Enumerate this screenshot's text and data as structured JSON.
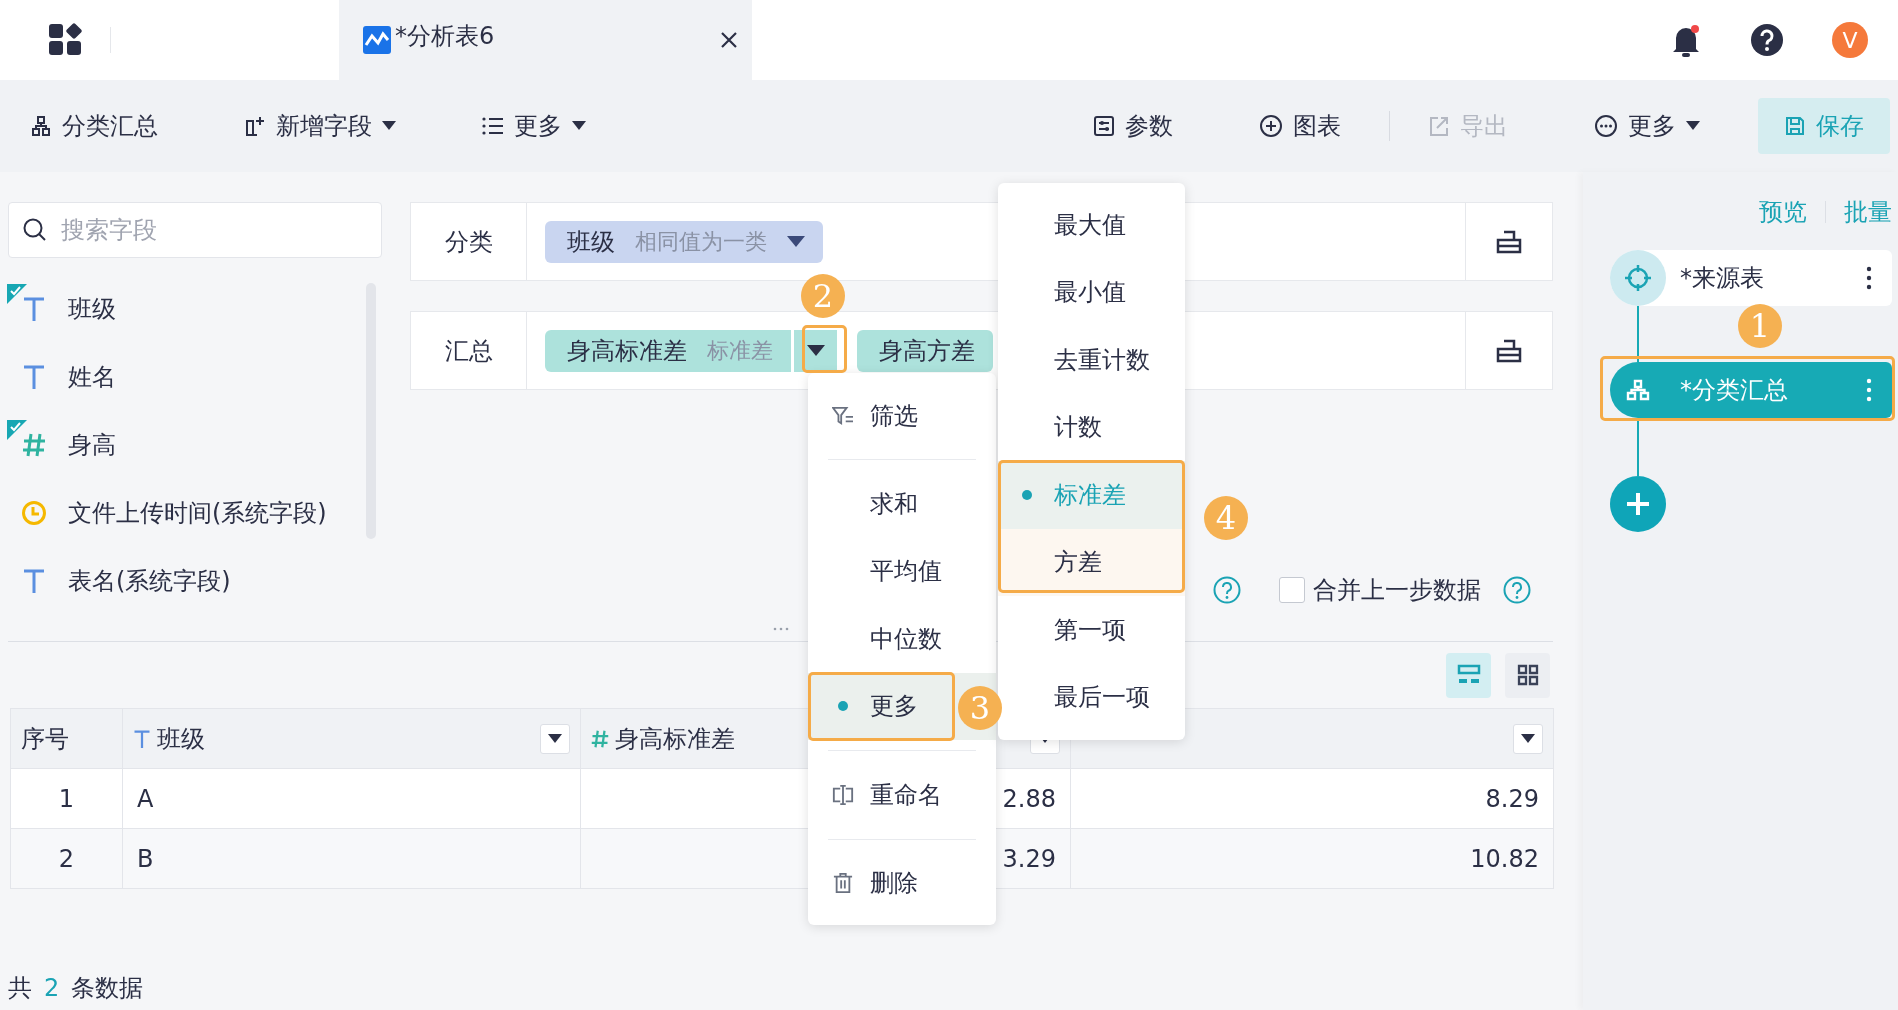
{
  "app_tab": {
    "title": "*分析表6"
  },
  "avatar": "V",
  "toolbar": {
    "left": [
      {
        "label": "分类汇总",
        "kind": "hierarchy",
        "dropdown": false,
        "disabled": false
      },
      {
        "label": "新增字段",
        "kind": "add-column",
        "dropdown": true,
        "disabled": false
      },
      {
        "label": "更多",
        "kind": "list",
        "dropdown": true,
        "disabled": false
      }
    ],
    "right": [
      {
        "label": "参数",
        "kind": "params",
        "dropdown": false,
        "disabled": false
      },
      {
        "label": "图表",
        "kind": "add",
        "dropdown": false,
        "disabled": false
      },
      {
        "label": "导出",
        "kind": "export",
        "dropdown": false,
        "disabled": true
      },
      {
        "label": "更多",
        "kind": "more",
        "dropdown": true,
        "disabled": false
      }
    ],
    "save": "保存"
  },
  "field_search": {
    "placeholder": "搜索字段"
  },
  "fields": [
    {
      "name": "班级",
      "kind": "text",
      "checked": true
    },
    {
      "name": "姓名",
      "kind": "text",
      "checked": false
    },
    {
      "name": "身高",
      "kind": "number",
      "checked": true
    },
    {
      "name": "文件上传时间(系统字段)",
      "kind": "time",
      "checked": false
    },
    {
      "name": "表名(系统字段)",
      "kind": "text",
      "checked": false
    }
  ],
  "config_rows": [
    {
      "label": "分类",
      "chips": [
        {
          "name": "班级",
          "hint": "相同值为一类",
          "kind": "dimension",
          "toggle": true
        }
      ]
    },
    {
      "label": "汇总",
      "chips": [
        {
          "name": "身高标准差",
          "hint": "标准差",
          "kind": "measure",
          "toggle": true
        },
        {
          "name": "身高方差",
          "kind": "measure",
          "toggle": false
        }
      ]
    }
  ],
  "merge": {
    "label": "合并上一步数据",
    "checked": false
  },
  "view_toggle": [
    {
      "kind": "rows",
      "selected": true
    },
    {
      "kind": "grid",
      "selected": false
    }
  ],
  "table": {
    "columns": [
      {
        "label": "序号",
        "kind": "index",
        "filter": false
      },
      {
        "label": "班级",
        "kind": "text",
        "filter": true
      },
      {
        "label": "身高标准差",
        "kind": "number",
        "filter": true
      },
      {
        "kind": "number",
        "filter": true
      }
    ],
    "rows": [
      [
        "1",
        "A",
        "2.88",
        "8.29"
      ],
      [
        "2",
        "B",
        "3.29",
        "10.82"
      ]
    ]
  },
  "footer": {
    "prefix": "共",
    "count": "2",
    "suffix": "条数据"
  },
  "flow": {
    "links": [
      "预览",
      "批量"
    ],
    "nodes": [
      {
        "label": "*来源表",
        "kind": "source",
        "selected": false
      },
      {
        "label": "*分类汇总",
        "kind": "summary",
        "selected": true
      }
    ]
  },
  "field_menu": [
    {
      "label": "筛选",
      "kind": "filter"
    },
    {
      "label": "求和",
      "kind": "option",
      "selected": false
    },
    {
      "label": "平均值",
      "kind": "option",
      "selected": false
    },
    {
      "label": "中位数",
      "kind": "option",
      "selected": false
    },
    {
      "label": "更多",
      "kind": "option",
      "selected": true
    },
    {
      "label": "重命名",
      "kind": "rename"
    },
    {
      "label": "删除",
      "kind": "delete"
    }
  ],
  "sub_menu": [
    {
      "label": "最大值",
      "selected": false,
      "hovered": false
    },
    {
      "label": "最小值",
      "selected": false,
      "hovered": false
    },
    {
      "label": "去重计数",
      "selected": false,
      "hovered": false
    },
    {
      "label": "计数",
      "selected": false,
      "hovered": false
    },
    {
      "label": "标准差",
      "selected": true,
      "hovered": false
    },
    {
      "label": "方差",
      "selected": false,
      "hovered": true
    },
    {
      "label": "第一项",
      "selected": false,
      "hovered": false
    },
    {
      "label": "最后一项",
      "selected": false,
      "hovered": false
    }
  ],
  "callouts": [
    {
      "number": "1",
      "kind": "flow-node"
    },
    {
      "number": "2",
      "kind": "chip-toggle"
    },
    {
      "number": "3",
      "kind": "more-item"
    },
    {
      "number": "4",
      "kind": "sub-options"
    }
  ]
}
